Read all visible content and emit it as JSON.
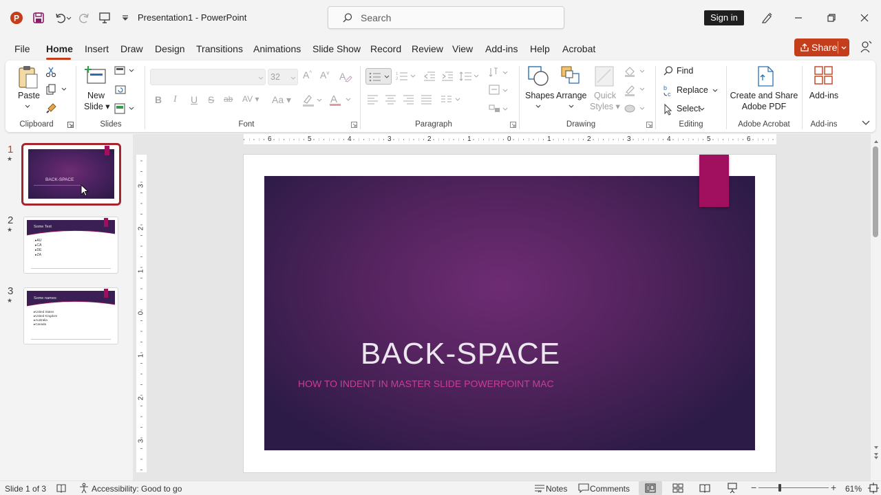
{
  "app": {
    "title": "Presentation1",
    "separator": "-",
    "name": "PowerPoint"
  },
  "search": {
    "placeholder": "Search"
  },
  "account": {
    "sign_in": "Sign in"
  },
  "tabs": [
    "File",
    "Home",
    "Insert",
    "Draw",
    "Design",
    "Transitions",
    "Animations",
    "Slide Show",
    "Record",
    "Review",
    "View",
    "Add-ins",
    "Help",
    "Acrobat"
  ],
  "share": {
    "label": "Share"
  },
  "ribbon": {
    "clipboard": {
      "paste": "Paste",
      "label": "Clipboard"
    },
    "slides": {
      "new": "New",
      "slide": "Slide",
      "label": "Slides"
    },
    "font": {
      "size": "32",
      "label": "Font"
    },
    "paragraph": {
      "label": "Paragraph"
    },
    "drawing": {
      "shapes": "Shapes",
      "arrange": "Arrange",
      "quick": "Quick",
      "styles": "Styles",
      "label": "Drawing"
    },
    "editing": {
      "find": "Find",
      "replace": "Replace",
      "select": "Select",
      "label": "Editing"
    },
    "acrobat": {
      "line1": "Create and Share",
      "line2": "Adobe PDF",
      "label": "Adobe Acrobat"
    },
    "addins": {
      "btn": "Add-ins",
      "label": "Add-ins"
    }
  },
  "slides": [
    {
      "num": "1",
      "title": "BACK-SPACE"
    },
    {
      "num": "2",
      "title": "Some Text",
      "bullets": [
        "AU",
        "CA",
        "DE",
        "ZA"
      ]
    },
    {
      "num": "3",
      "title": "Some names:",
      "bullets": [
        "United States",
        "United Kingdom",
        "Australia",
        "Canada"
      ]
    }
  ],
  "ruler": {
    "h": [
      "6",
      "5",
      "4",
      "3",
      "2",
      "1",
      "0",
      "1",
      "2",
      "3",
      "4",
      "5",
      "6"
    ],
    "v": [
      "3",
      "2",
      "1",
      "0",
      "1",
      "2",
      "3"
    ]
  },
  "main_slide": {
    "title": "BACK-SPACE",
    "subtitle": "HOW TO INDENT IN MASTER SLIDE POWERPOINT MAC"
  },
  "status": {
    "slide": "Slide 1 of 3",
    "accessibility": "Accessibility: Good to go",
    "notes": "Notes",
    "comments": "Comments",
    "zoom": "61%"
  },
  "colors": {
    "accent": "#c43e1c",
    "slide_bg_center": "#6a2a6e",
    "slide_bg_edge": "#2a1a45",
    "magenta_tab": "#a0105e",
    "subtitle": "#c93d96"
  }
}
